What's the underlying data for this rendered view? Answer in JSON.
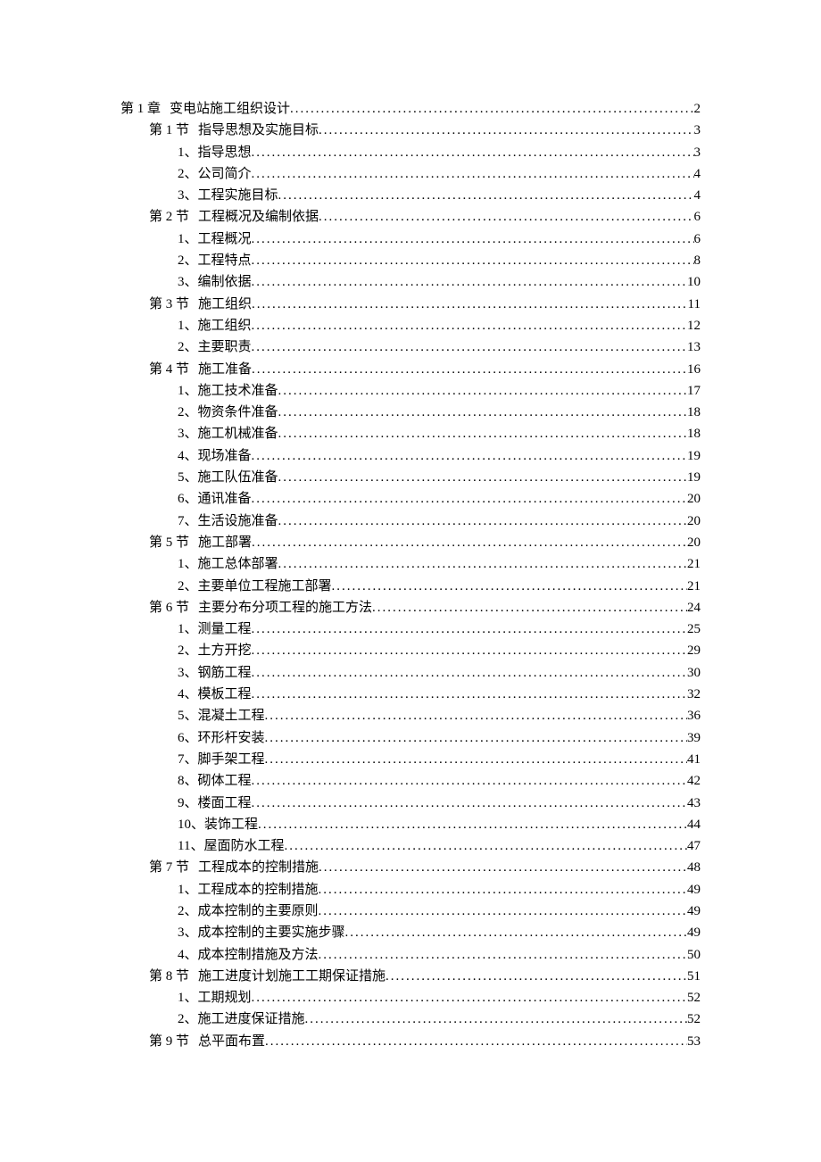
{
  "toc": [
    {
      "level": 0,
      "label": "第 1 章",
      "title": "变电站施工组织设计",
      "page": "2"
    },
    {
      "level": 1,
      "label": "第 1 节",
      "title": "指导思想及实施目标",
      "page": "3"
    },
    {
      "level": 2,
      "label": "1、",
      "title": "指导思想",
      "page": "3"
    },
    {
      "level": 2,
      "label": "2、",
      "title": "公司简介",
      "page": "4"
    },
    {
      "level": 2,
      "label": "3、",
      "title": "工程实施目标",
      "page": "4"
    },
    {
      "level": 1,
      "label": "第 2 节",
      "title": "工程概况及编制依据",
      "page": "6"
    },
    {
      "level": 2,
      "label": "1、",
      "title": "工程概况",
      "page": "6"
    },
    {
      "level": 2,
      "label": "2、",
      "title": "工程特点",
      "page": "8"
    },
    {
      "level": 2,
      "label": "3、",
      "title": "编制依据",
      "page": "10"
    },
    {
      "level": 1,
      "label": "第 3 节",
      "title": "施工组织",
      "page": "11"
    },
    {
      "level": 2,
      "label": "1、",
      "title": "施工组织",
      "page": "12"
    },
    {
      "level": 2,
      "label": "2、",
      "title": "主要职责",
      "page": "13"
    },
    {
      "level": 1,
      "label": "第 4 节",
      "title": "施工准备",
      "page": "16"
    },
    {
      "level": 2,
      "label": "1、",
      "title": "施工技术准备",
      "page": "17"
    },
    {
      "level": 2,
      "label": "2、",
      "title": "物资条件准备",
      "page": "18"
    },
    {
      "level": 2,
      "label": "3、",
      "title": "施工机械准备",
      "page": "18"
    },
    {
      "level": 2,
      "label": "4、",
      "title": "现场准备",
      "page": "19"
    },
    {
      "level": 2,
      "label": "5、",
      "title": "施工队伍准备",
      "page": "19"
    },
    {
      "level": 2,
      "label": "6、",
      "title": "通讯准备",
      "page": "20"
    },
    {
      "level": 2,
      "label": "7、",
      "title": "生活设施准备",
      "page": "20"
    },
    {
      "level": 1,
      "label": "第 5 节",
      "title": "施工部署",
      "page": "20"
    },
    {
      "level": 2,
      "label": "1、",
      "title": "施工总体部署",
      "page": "21"
    },
    {
      "level": 2,
      "label": "2、",
      "title": "主要单位工程施工部署",
      "page": "21"
    },
    {
      "level": 1,
      "label": "第 6 节",
      "title": "主要分布分项工程的施工方法",
      "page": "24"
    },
    {
      "level": 2,
      "label": "1、",
      "title": "测量工程",
      "page": "25"
    },
    {
      "level": 2,
      "label": "2、",
      "title": "土方开挖",
      "page": "29"
    },
    {
      "level": 2,
      "label": "3、",
      "title": "钢筋工程",
      "page": "30"
    },
    {
      "level": 2,
      "label": "4、",
      "title": "模板工程",
      "page": "32"
    },
    {
      "level": 2,
      "label": "5、",
      "title": "混凝土工程",
      "page": "36"
    },
    {
      "level": 2,
      "label": "6、",
      "title": "环形杆安装",
      "page": "39"
    },
    {
      "level": 2,
      "label": "7、",
      "title": "脚手架工程",
      "page": "41"
    },
    {
      "level": 2,
      "label": "8、",
      "title": "砌体工程",
      "page": "42"
    },
    {
      "level": 2,
      "label": "9、",
      "title": "楼面工程",
      "page": "43"
    },
    {
      "level": 2,
      "label": "10、",
      "title": "装饰工程",
      "page": "44"
    },
    {
      "level": 2,
      "label": "11、",
      "title": "屋面防水工程",
      "page": "47"
    },
    {
      "level": 1,
      "label": "第 7 节",
      "title": "工程成本的控制措施",
      "page": "48"
    },
    {
      "level": 2,
      "label": "1、",
      "title": "工程成本的控制措施",
      "page": "49"
    },
    {
      "level": 2,
      "label": "2、",
      "title": "成本控制的主要原则",
      "page": "49"
    },
    {
      "level": 2,
      "label": "3、",
      "title": "成本控制的主要实施步骤",
      "page": "49"
    },
    {
      "level": 2,
      "label": "4、",
      "title": "成本控制措施及方法",
      "page": "50"
    },
    {
      "level": 1,
      "label": "第 8 节",
      "title": "施工进度计划施工工期保证措施",
      "page": "51"
    },
    {
      "level": 2,
      "label": "1、",
      "title": "工期规划",
      "page": "52"
    },
    {
      "level": 2,
      "label": "2、",
      "title": "施工进度保证措施",
      "page": "52"
    },
    {
      "level": 1,
      "label": "第 9 节",
      "title": "总平面布置",
      "page": "53"
    }
  ]
}
